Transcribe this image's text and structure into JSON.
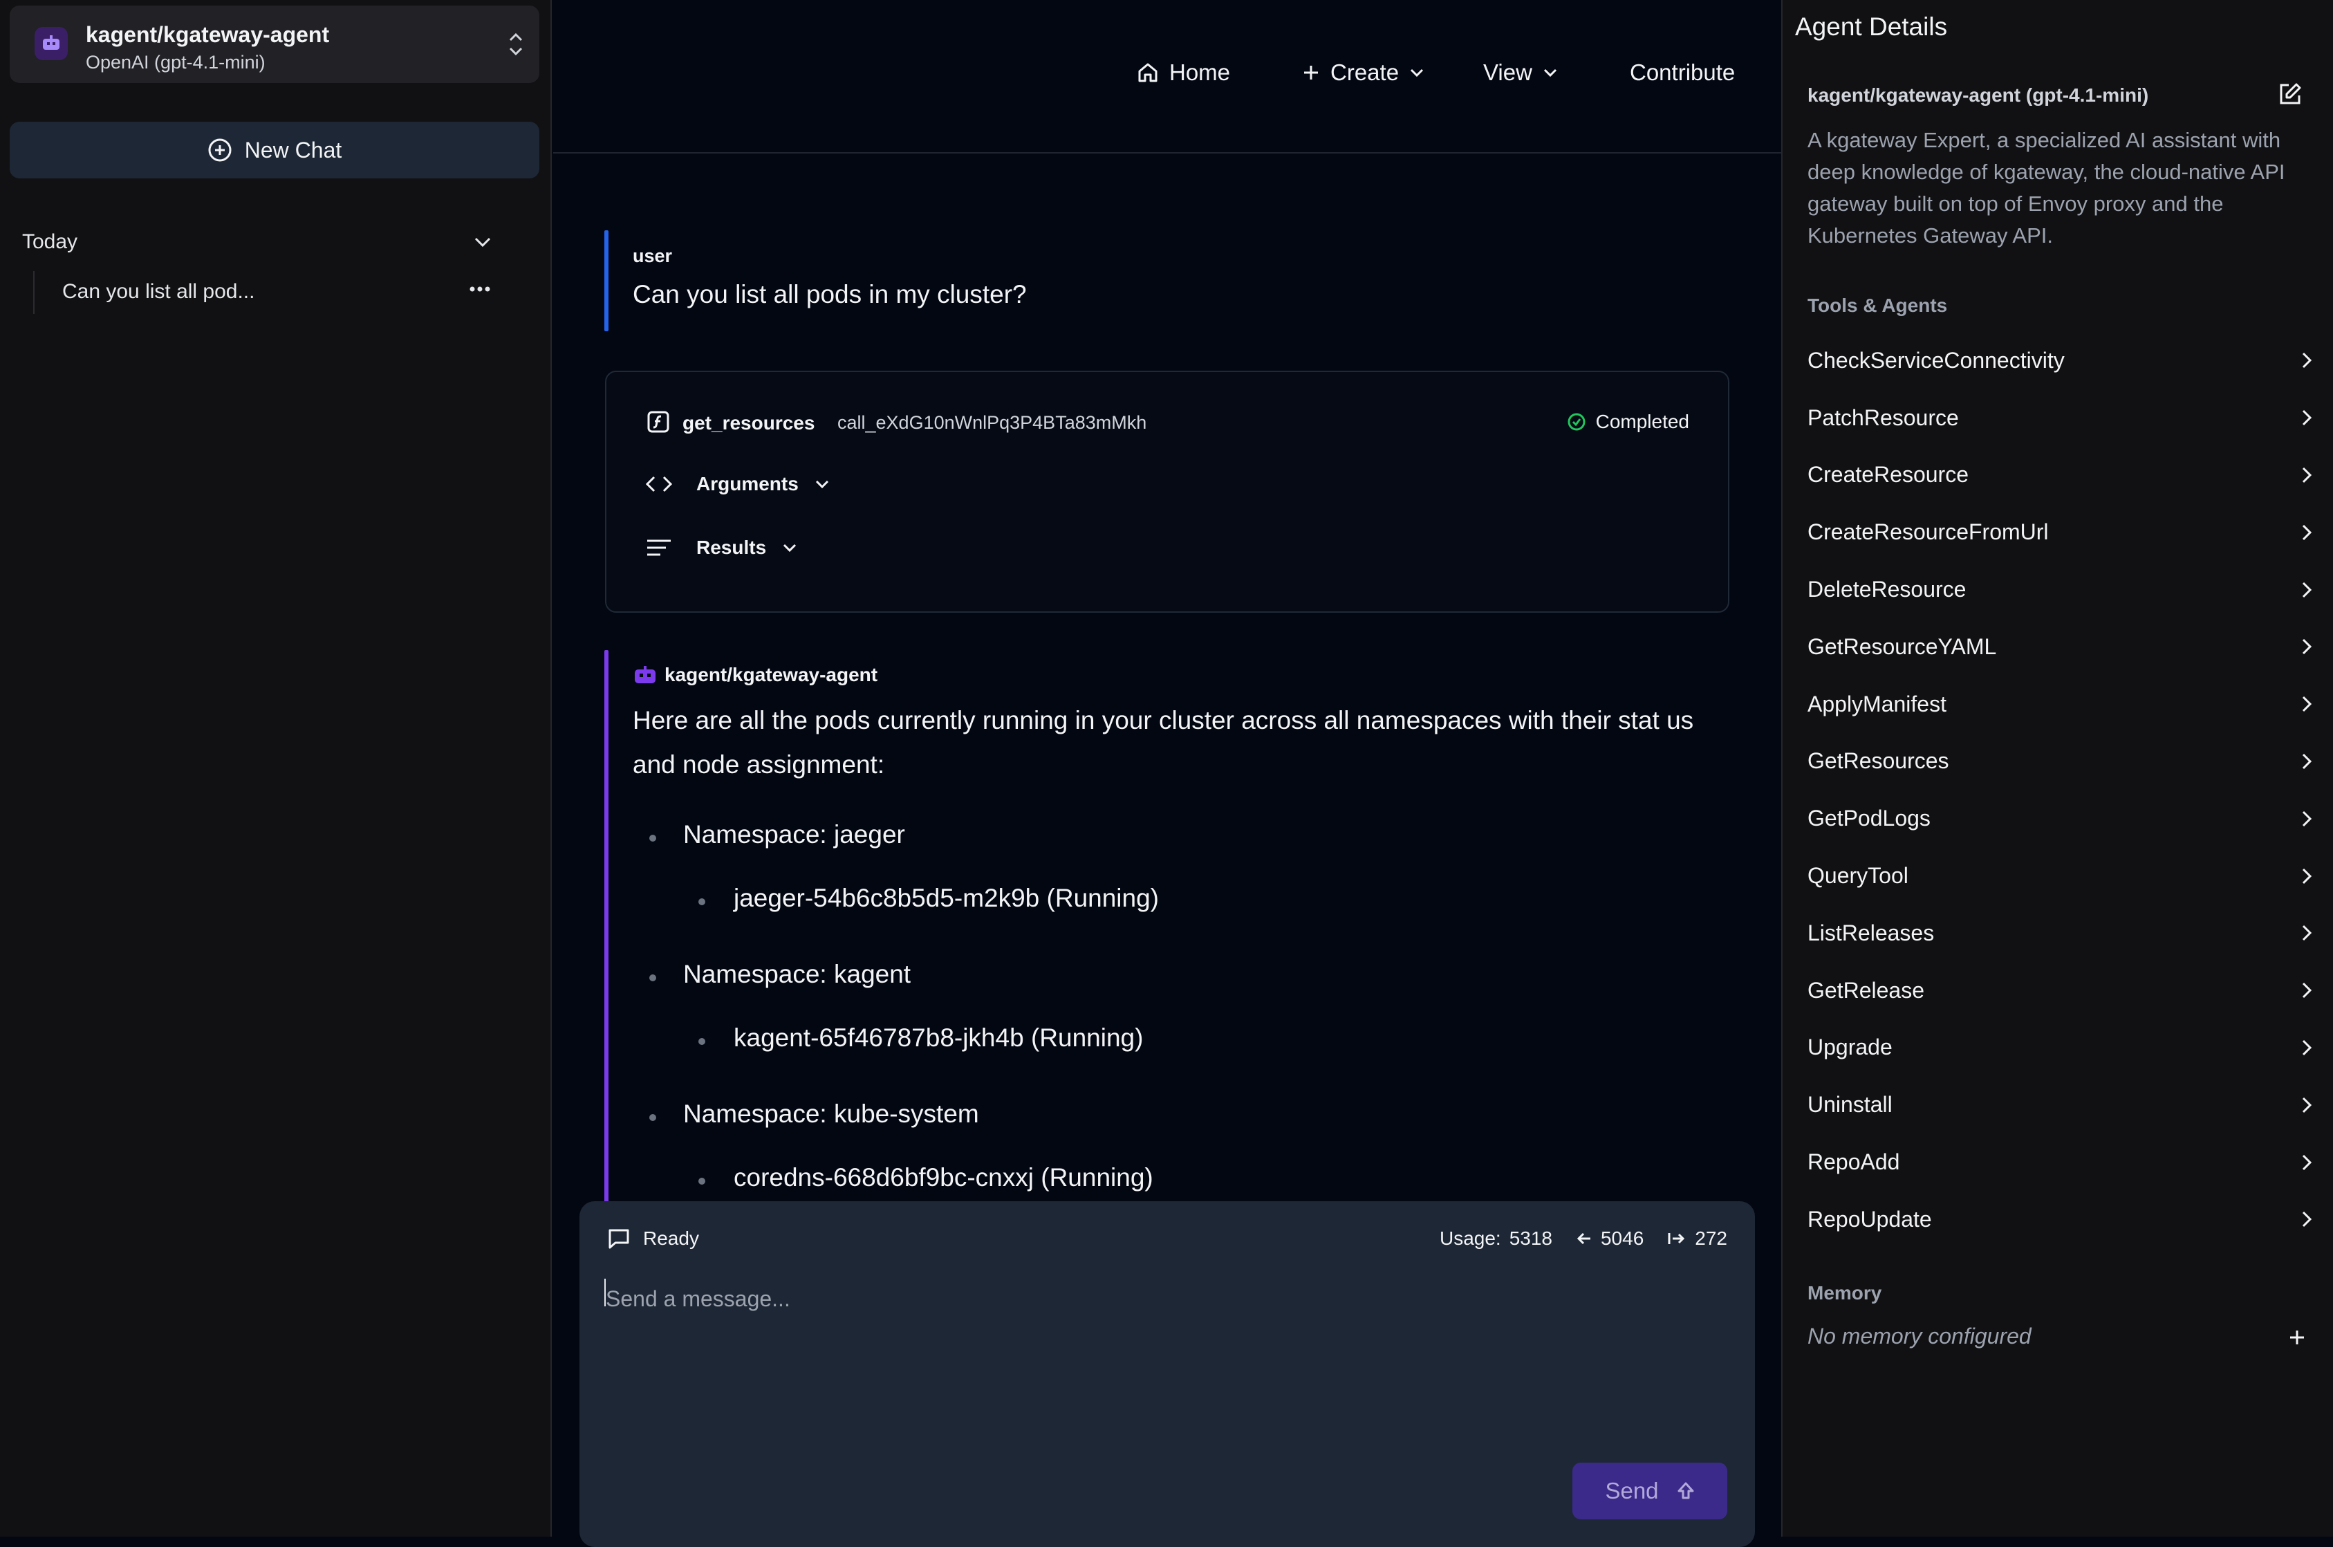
{
  "sidebar": {
    "agent": {
      "name": "kagent/kgateway-agent",
      "model": "OpenAI (gpt-4.1-mini)"
    },
    "new_chat_label": "New Chat",
    "history_group": "Today",
    "history_items": [
      {
        "title": "Can you list all pod..."
      }
    ]
  },
  "nav": {
    "home": "Home",
    "create": "Create",
    "view": "View",
    "contribute": "Contribute"
  },
  "chat": {
    "user_message": {
      "role": "user",
      "text": "Can you list all pods in my cluster?"
    },
    "tool_call": {
      "name": "get_resources",
      "call_id": "call_eXdG10nWnlPq3P4BTa83mMkh",
      "status": "Completed",
      "arguments_label": "Arguments",
      "results_label": "Results"
    },
    "agent_message": {
      "author": "kagent/kgateway-agent",
      "intro": "Here are all the pods currently running in your cluster across all namespaces with their stat us and node assignment:",
      "namespaces": [
        {
          "label": "Namespace: jaeger",
          "pod": "jaeger-54b6c8b5d5-m2k9b (Running)"
        },
        {
          "label": "Namespace: kagent",
          "pod": "kagent-65f46787b8-jkh4b (Running)"
        },
        {
          "label": "Namespace: kube-system",
          "pod": "coredns-668d6bf9bc-cnxxj (Running)"
        }
      ]
    }
  },
  "composer": {
    "status": "Ready",
    "usage_label": "Usage:",
    "usage_total": "5318",
    "usage_input": "5046",
    "usage_output": "272",
    "placeholder": "Send a message...",
    "send_label": "Send"
  },
  "details": {
    "title": "Agent Details",
    "name": "kagent/kgateway-agent (gpt-4.1-mini)",
    "description": "A kgateway Expert, a specialized AI assistant with deep knowledge of kgateway, the cloud-native API gateway built on top of Envoy proxy and the Kubernetes Gateway API.",
    "tools_label": "Tools & Agents",
    "tools": [
      "CheckServiceConnectivity",
      "PatchResource",
      "CreateResource",
      "CreateResourceFromUrl",
      "DeleteResource",
      "GetResourceYAML",
      "ApplyManifest",
      "GetResources",
      "GetPodLogs",
      "QueryTool",
      "ListReleases",
      "GetRelease",
      "Upgrade",
      "Uninstall",
      "RepoAdd",
      "RepoUpdate"
    ],
    "memory_label": "Memory",
    "memory_empty": "No memory configured"
  },
  "colors": {
    "background": "#030712",
    "panel": "#111113",
    "accent_purple": "#7c3aed",
    "accent_blue": "#2563eb",
    "success": "#22c55e"
  }
}
